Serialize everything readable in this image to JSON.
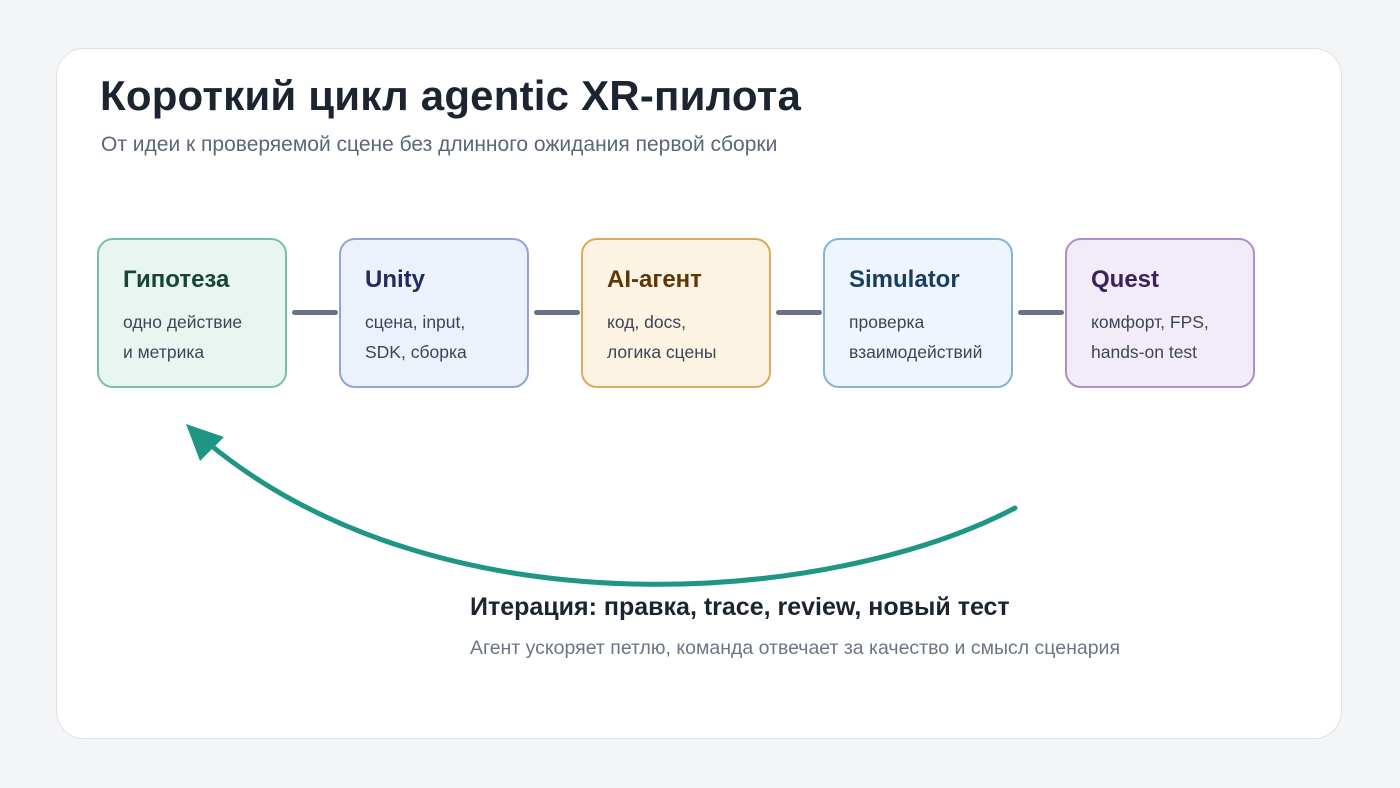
{
  "header": {
    "title": "Короткий цикл agentic XR-пилота",
    "subtitle": "От идеи к проверяемой сцене без длинного ожидания первой сборки"
  },
  "steps": [
    {
      "name": "Гипотеза",
      "line1": "одно действие",
      "line2": "и метрика",
      "fill": "#e9f5f1",
      "border": "#79bfa8",
      "title_color": "#164636"
    },
    {
      "name": "Unity",
      "line1": "сцена, input,",
      "line2": "SDK, сборка",
      "fill": "#edf1fb",
      "border": "#91a4d6",
      "title_color": "#1e2d5e"
    },
    {
      "name": "AI-агент",
      "line1": "код, docs,",
      "line2": "логика сцены",
      "fill": "#fdf3e3",
      "border": "#dcaa5e",
      "title_color": "#5e3708"
    },
    {
      "name": "Simulator",
      "line1": "проверка",
      "line2": "взаимодействий",
      "fill": "#eef5fd",
      "border": "#86b4d8",
      "title_color": "#173e5f"
    },
    {
      "name": "Quest",
      "line1": "комфорт, FPS,",
      "line2": "hands-on test",
      "fill": "#f2ebf8",
      "border": "#ab91cc",
      "title_color": "#3c2357"
    }
  ],
  "loop": {
    "title": "Итерация: правка, trace, review, новый тест",
    "subtitle": "Агент ускоряет петлю, команда отвечает за качество и смысл сценария",
    "arrow_color": "#1f9684"
  },
  "colors": {
    "background": "#f4f5f7",
    "card": "#ffffff",
    "connector": "#687385"
  }
}
